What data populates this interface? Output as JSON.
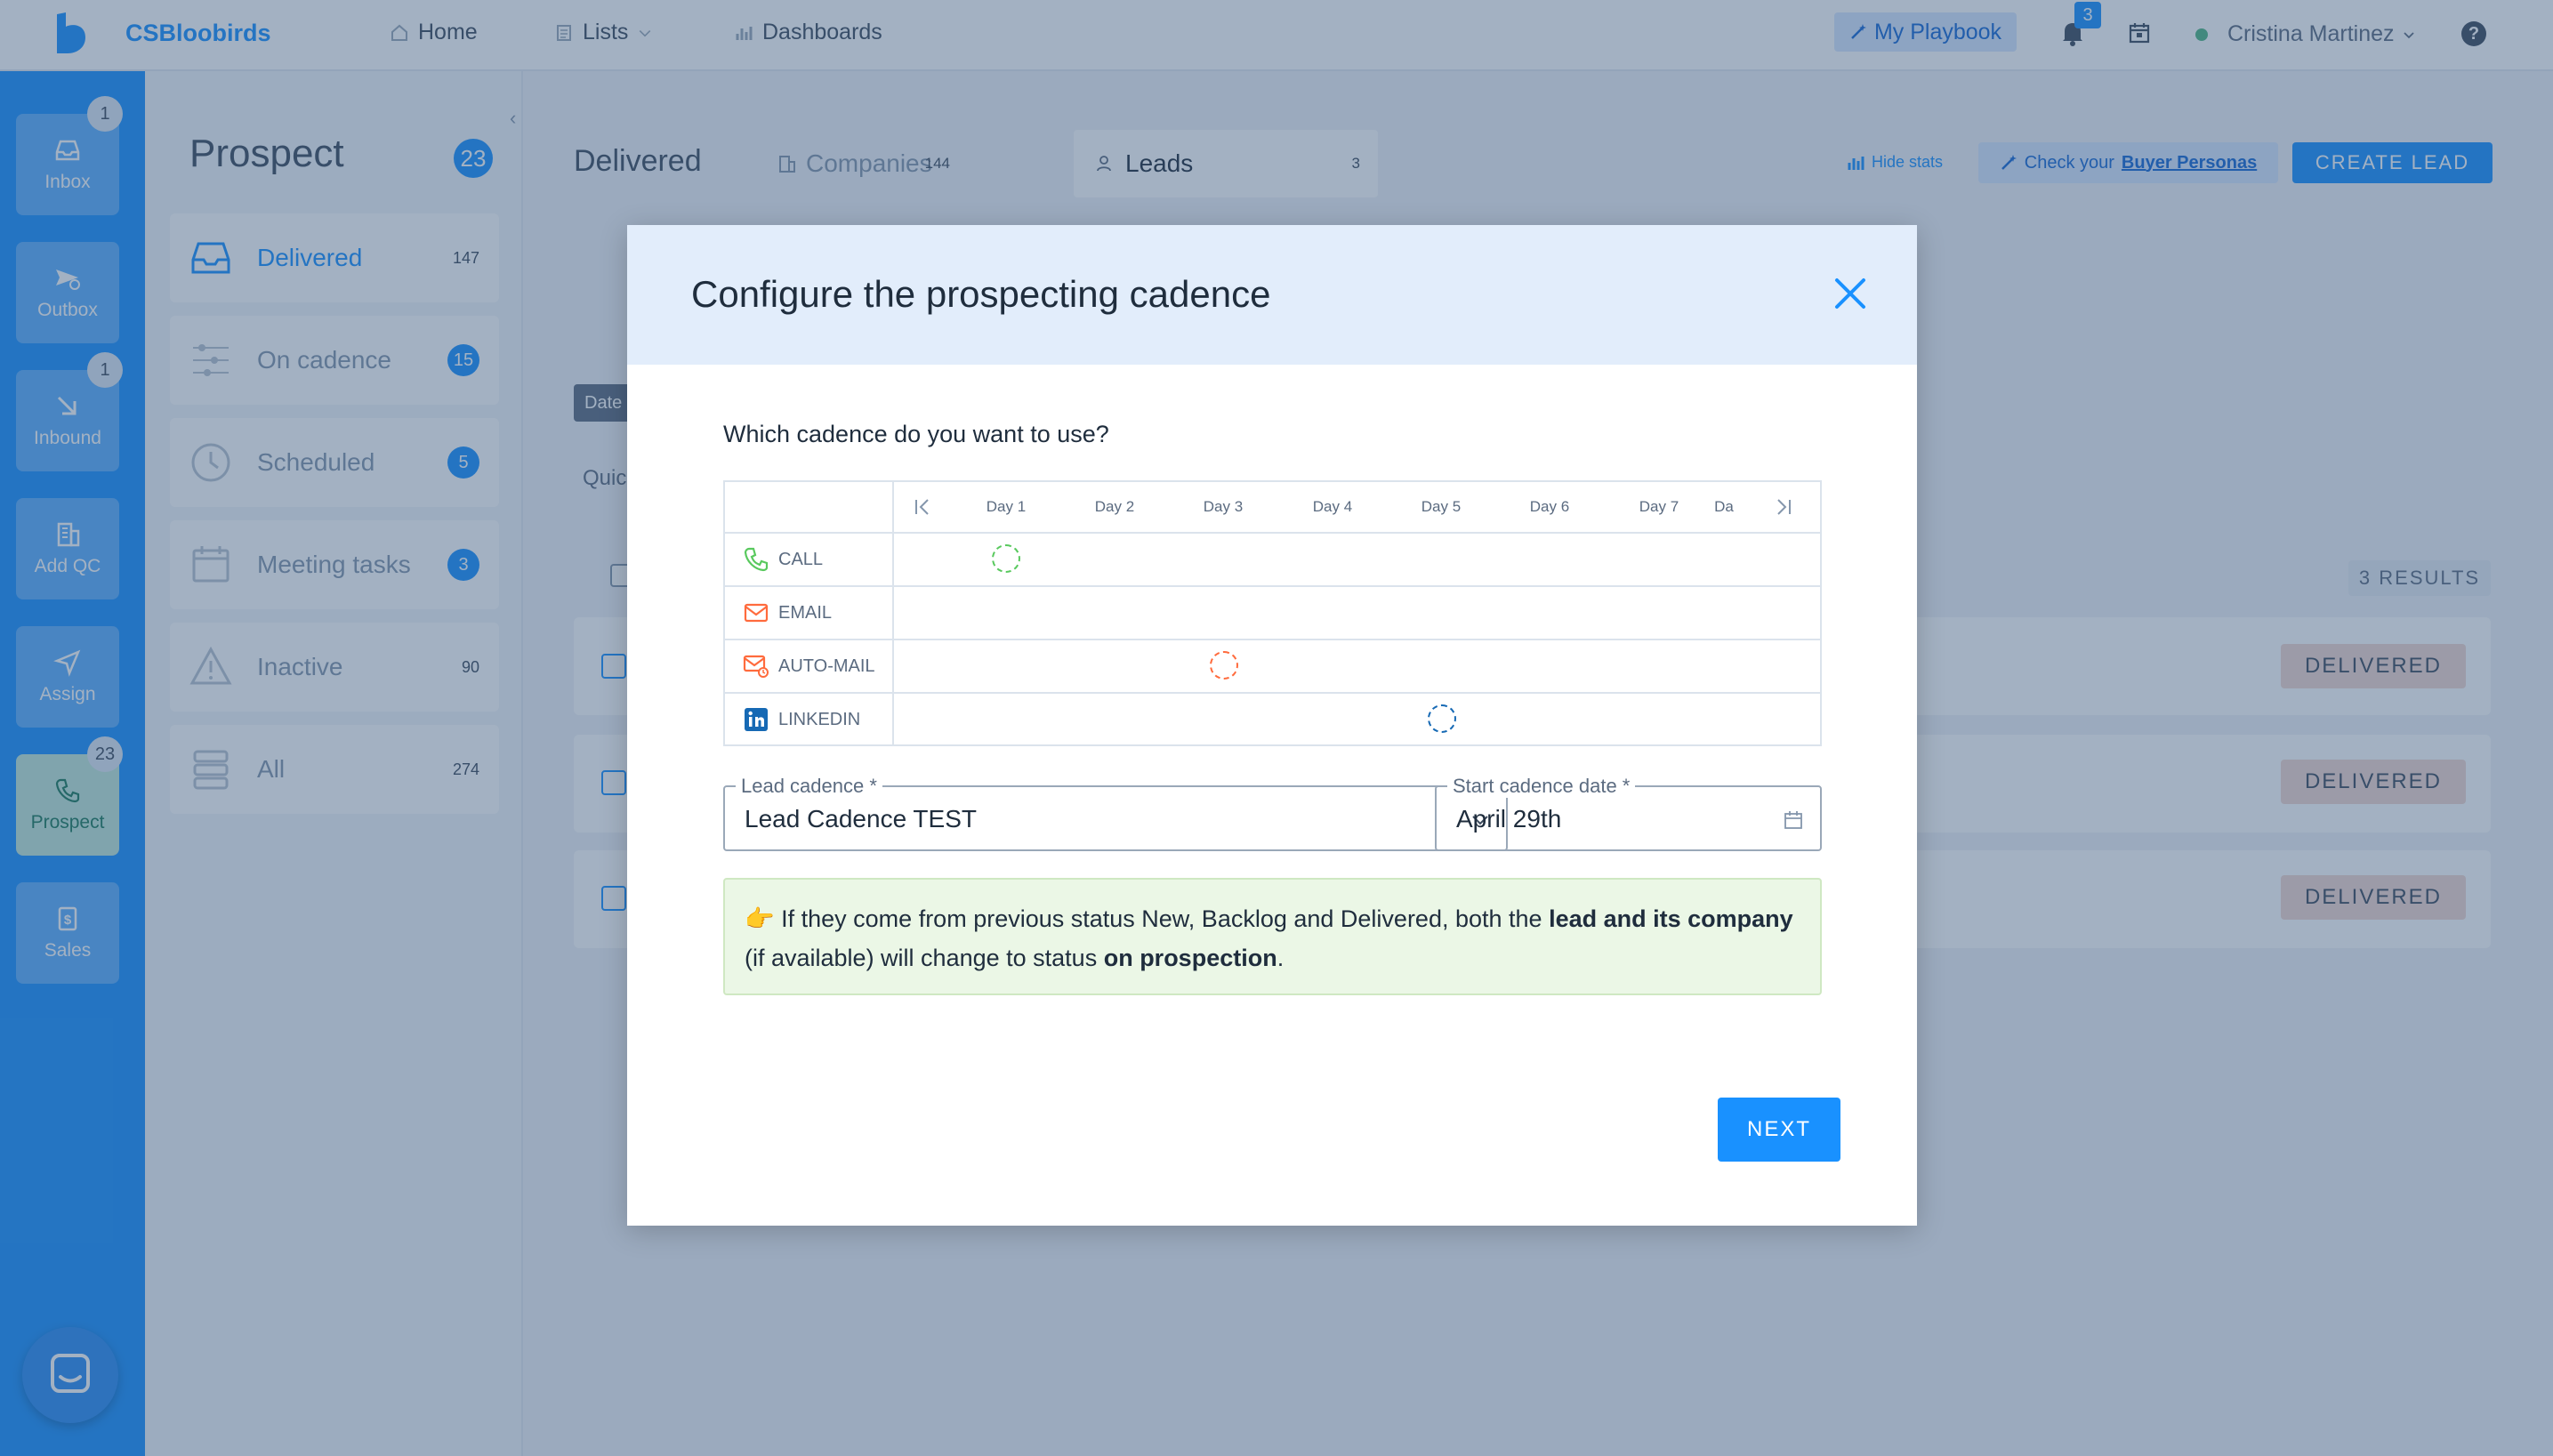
{
  "topbar": {
    "brand": "CSBloobirds",
    "nav": [
      {
        "label": "Home",
        "icon": "home-icon"
      },
      {
        "label": "Lists",
        "icon": "list-icon"
      },
      {
        "label": "Dashboards",
        "icon": "chart-icon"
      }
    ],
    "playbook_label": "My Playbook",
    "notifications_count": "3",
    "user_name": "Cristina Martinez",
    "help_label": "?"
  },
  "rail": {
    "items": [
      {
        "label": "Inbox",
        "badge": "1"
      },
      {
        "label": "Outbox",
        "badge": ""
      },
      {
        "label": "Inbound",
        "badge": "1"
      },
      {
        "label": "Add QC",
        "badge": ""
      },
      {
        "label": "Assign",
        "badge": ""
      },
      {
        "label": "Prospect",
        "badge": "23"
      },
      {
        "label": "Sales",
        "badge": ""
      }
    ]
  },
  "side_panel": {
    "title": "Prospect",
    "title_count": "23",
    "items": [
      {
        "label": "Delivered",
        "count": "147"
      },
      {
        "label": "On cadence",
        "count": "15"
      },
      {
        "label": "Scheduled",
        "count": "5"
      },
      {
        "label": "Meeting tasks",
        "count": "3"
      },
      {
        "label": "Inactive",
        "count": "90"
      },
      {
        "label": "All",
        "count": "274"
      }
    ]
  },
  "main": {
    "title": "Delivered",
    "tabs": [
      {
        "label": "Companies",
        "count": "144"
      },
      {
        "label": "Leads",
        "count": "3"
      }
    ],
    "hide_stats": "Hide stats",
    "personas_prefix": "Check your",
    "personas_link": "Buyer Personas",
    "create_lead": "CREATE LEAD",
    "date_chip": "Date",
    "quick": "Quic",
    "results": "3 RESULTS",
    "rows": [
      {
        "status": "DELIVERED"
      },
      {
        "status": "DELIVERED"
      },
      {
        "status": "DELIVERED"
      }
    ]
  },
  "modal": {
    "title": "Configure the prospecting cadence",
    "question": "Which cadence do you want to use?",
    "days": [
      "Day 1",
      "Day 2",
      "Day 3",
      "Day 4",
      "Day 5",
      "Day 6",
      "Day 7",
      "Da"
    ],
    "channels": [
      {
        "label": "CALL",
        "icon": "phone-icon",
        "color": "#59c95e",
        "day_index": 0
      },
      {
        "label": "EMAIL",
        "icon": "email-icon",
        "color": "#ff6b3d",
        "day_index": null
      },
      {
        "label": "AUTO-MAIL",
        "icon": "auto-mail-icon",
        "color": "#ff6b3d",
        "day_index": 2
      },
      {
        "label": "LINKEDIN",
        "icon": "linkedin-icon",
        "color": "#1669b4",
        "day_index": 4
      }
    ],
    "lead_cadence_label": "Lead cadence *",
    "lead_cadence_value": "Lead Cadence TEST",
    "start_date_label": "Start cadence date *",
    "start_date_value": "April 29th",
    "info": {
      "emoji": "👉",
      "t1": " If they come from previous status New, Backlog and Delivered, both the ",
      "b1": "lead and its company",
      "t2": " (if available) will change to status ",
      "b2": "on prospection",
      "t3": "."
    },
    "next_label": "NEXT"
  }
}
